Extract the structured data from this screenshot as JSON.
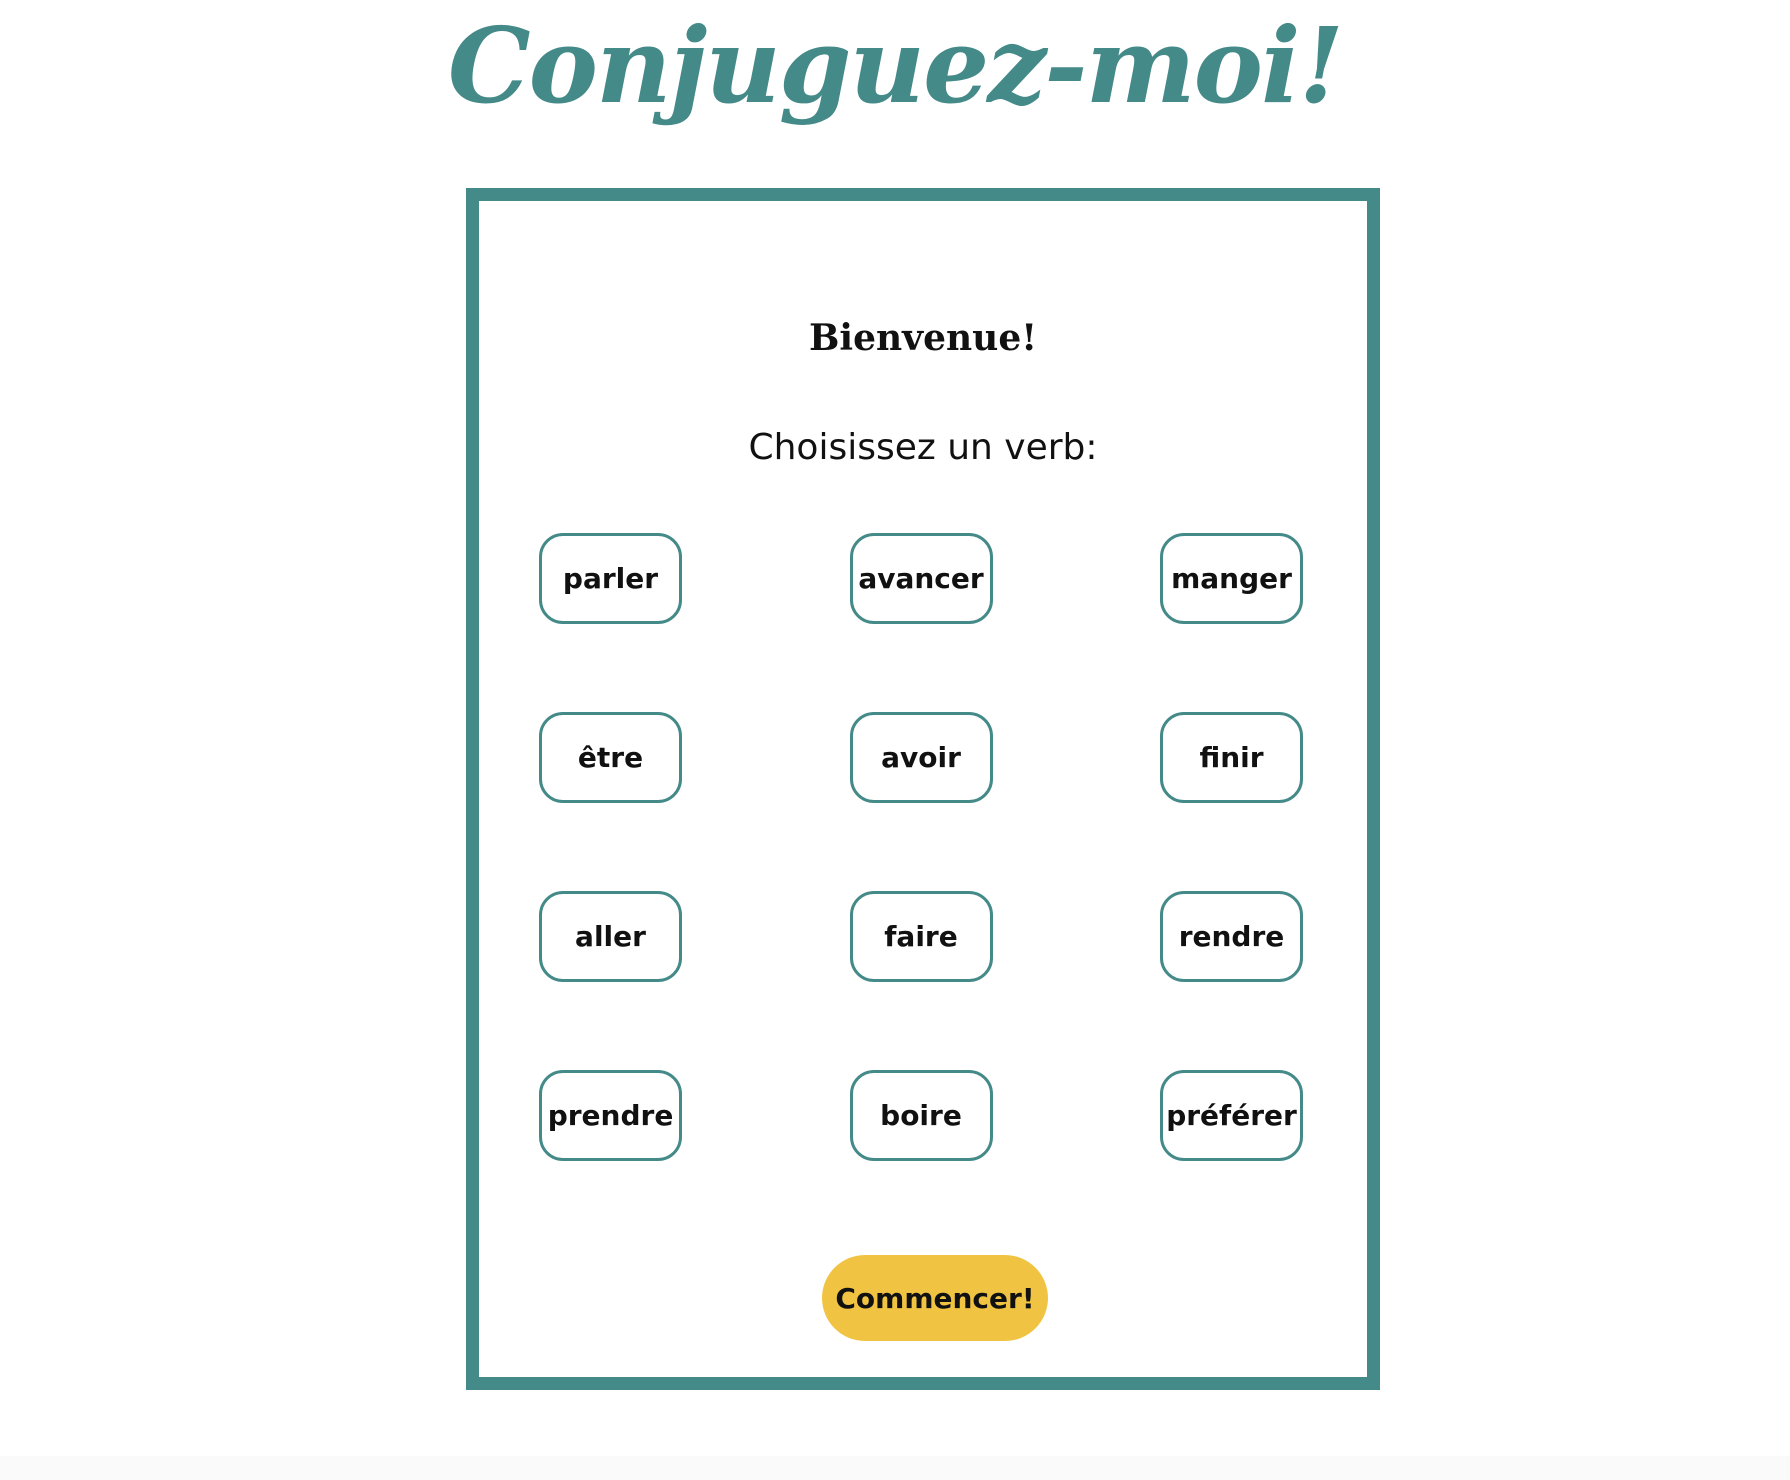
{
  "header": {
    "title": "Conjuguez-moi!"
  },
  "card": {
    "welcome": "Bienvenue!",
    "prompt": "Choisissez un verb:",
    "verbs": [
      "parler",
      "avancer",
      "manger",
      "être",
      "avoir",
      "finir",
      "aller",
      "faire",
      "rendre",
      "prendre",
      "boire",
      "préférer"
    ],
    "start_label": "Commencer!"
  },
  "colors": {
    "accent": "#448a88",
    "start_button": "#f0c442",
    "text": "#111111",
    "background": "#ffffff"
  }
}
